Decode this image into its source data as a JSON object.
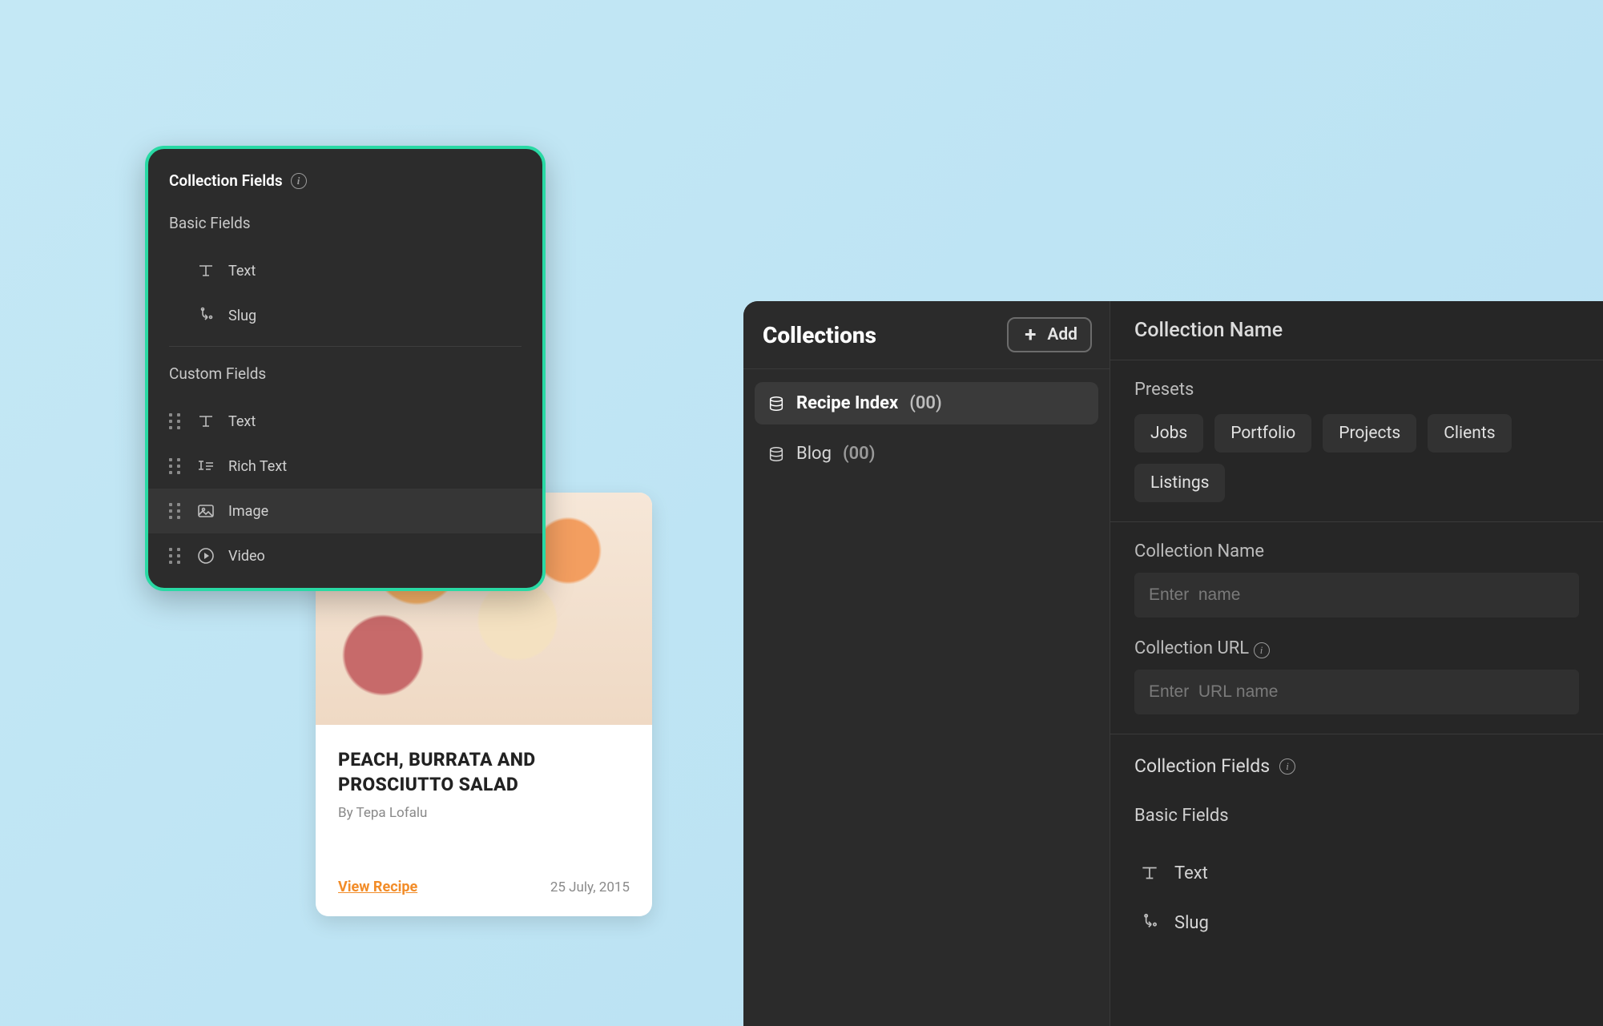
{
  "fields_panel": {
    "title": "Collection Fields",
    "basic_label": "Basic Fields",
    "basic": [
      {
        "label": "Text"
      },
      {
        "label": "Slug"
      }
    ],
    "custom_label": "Custom Fields",
    "custom": [
      {
        "label": "Text"
      },
      {
        "label": "Rich Text"
      },
      {
        "label": "Image"
      },
      {
        "label": "Video"
      }
    ]
  },
  "recipe_card": {
    "title": "PEACH, BURRATA AND PROSCIUTTO SALAD",
    "author": "By Tepa Lofalu",
    "link_label": "View Recipe",
    "date": "25 July, 2015"
  },
  "right_panel": {
    "left": {
      "title": "Collections",
      "add_label": "Add",
      "items": [
        {
          "name": "Recipe Index",
          "count": "(00)"
        },
        {
          "name": "Blog",
          "count": "(00)"
        }
      ]
    },
    "right": {
      "header": "Collection Name",
      "presets_label": "Presets",
      "presets": [
        "Jobs",
        "Portfolio",
        "Projects",
        "Clients",
        "Listings"
      ],
      "name_label": "Collection Name",
      "name_placeholder": "Enter  name",
      "url_label": "Collection URL",
      "url_placeholder": "Enter  URL name",
      "fields_title": "Collection Fields",
      "basic_label": "Basic Fields",
      "basic": [
        {
          "label": "Text"
        },
        {
          "label": "Slug"
        }
      ]
    }
  }
}
